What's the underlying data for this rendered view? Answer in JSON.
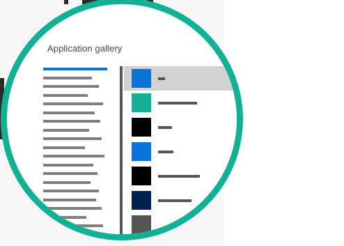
{
  "window": {
    "title": "Application gallery"
  },
  "colors": {
    "lens_ring": "#14b096",
    "selection_accent": "#0b72d6",
    "selected_row": "#d2d2d2"
  },
  "categories": [
    {
      "selected": true
    },
    {
      "selected": false
    },
    {
      "selected": false
    },
    {
      "selected": false
    },
    {
      "selected": false
    },
    {
      "selected": false
    },
    {
      "selected": false
    },
    {
      "selected": false
    },
    {
      "selected": false
    },
    {
      "selected": false
    },
    {
      "selected": false
    },
    {
      "selected": false
    },
    {
      "selected": false
    },
    {
      "selected": false
    },
    {
      "selected": false
    },
    {
      "selected": false
    },
    {
      "selected": false
    },
    {
      "selected": false
    },
    {
      "selected": false
    },
    {
      "selected": false
    }
  ],
  "apps": [
    {
      "tile_color": "#0b72d6",
      "selected": true
    },
    {
      "tile_color": "#14b096",
      "selected": false
    },
    {
      "tile_color": "#000000",
      "selected": false
    },
    {
      "tile_color": "#0b72d6",
      "selected": false
    },
    {
      "tile_color": "#000000",
      "selected": false
    },
    {
      "tile_color": "#00204d",
      "selected": false
    },
    {
      "tile_color": "#555555",
      "selected": false
    }
  ]
}
